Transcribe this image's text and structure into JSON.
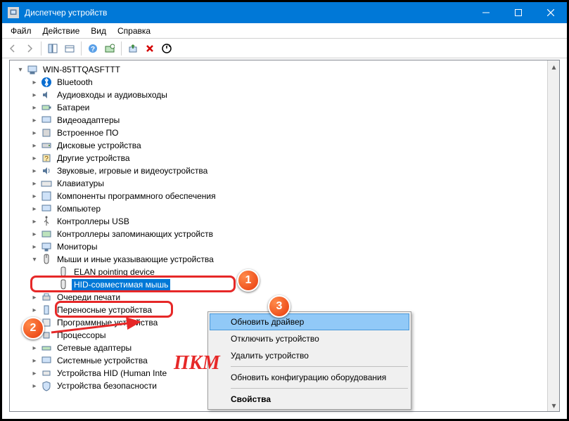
{
  "window": {
    "title": "Диспетчер устройств"
  },
  "menubar": {
    "file": "Файл",
    "action": "Действие",
    "view": "Вид",
    "help": "Справка"
  },
  "tree": {
    "root": "WIN-85TTQASFTTT",
    "categories": [
      "Bluetooth",
      "Аудиовходы и аудиовыходы",
      "Батареи",
      "Видеоадаптеры",
      "Встроенное ПО",
      "Дисковые устройства",
      "Другие устройства",
      "Звуковые, игровые и видеоустройства",
      "Клавиатуры",
      "Компоненты программного обеспечения",
      "Компьютер",
      "Контроллеры USB",
      "Контроллеры запоминающих устройств",
      "Мониторы",
      "Мыши и иные указывающие устройства",
      "Очереди печати",
      "Переносные устройства",
      "Программные устройства",
      "Процессоры",
      "Сетевые адаптеры",
      "Системные устройства",
      "Устройства HID (Human Inte",
      "Устройства безопасности"
    ],
    "mice_children": {
      "elan": "ELAN pointing device",
      "hid": "HID-совместимая мышь"
    }
  },
  "context_menu": {
    "update": "Обновить драйвер",
    "disable": "Отключить устройство",
    "remove": "Удалить устройство",
    "rescan": "Обновить конфигурацию оборудования",
    "props": "Свойства"
  },
  "annotations": {
    "b1": "1",
    "b2": "2",
    "b3": "3",
    "pkm": "ПКМ"
  }
}
